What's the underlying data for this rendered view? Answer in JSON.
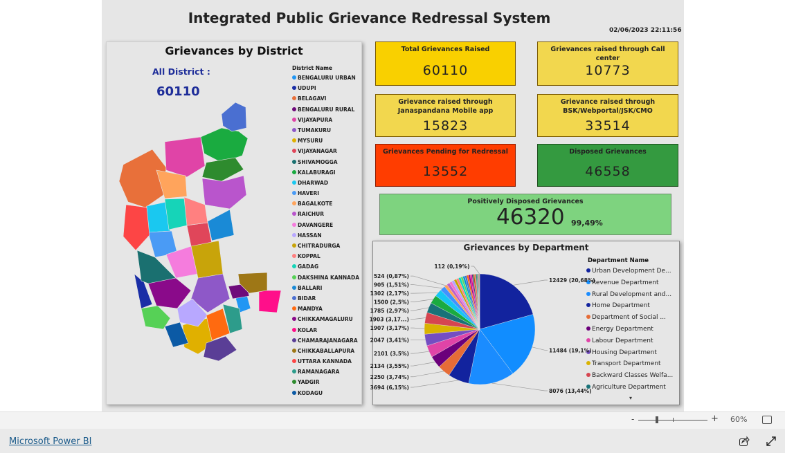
{
  "report": {
    "title": "Integrated Public Grievance Redressal System",
    "timestamp": "02/06/2023 22:11:56"
  },
  "district_panel": {
    "title": "Grievances by District",
    "all_label": "All District :",
    "all_value": "60110",
    "legend_title": "District Name",
    "districts": [
      {
        "name": "BENGALURU URBAN",
        "color": "#2196f3"
      },
      {
        "name": "UDUPI",
        "color": "#1a2ea6"
      },
      {
        "name": "BELAGAVI",
        "color": "#e8703a"
      },
      {
        "name": "BENGALURU RURAL",
        "color": "#6e0a7a"
      },
      {
        "name": "VIJAYAPURA",
        "color": "#e044a7"
      },
      {
        "name": "TUMAKURU",
        "color": "#8e58c8"
      },
      {
        "name": "MYSURU",
        "color": "#e0b000"
      },
      {
        "name": "VIJAYANAGAR",
        "color": "#e0465a"
      },
      {
        "name": "SHIVAMOGGA",
        "color": "#1a7070"
      },
      {
        "name": "KALABURAGI",
        "color": "#1aab40"
      },
      {
        "name": "DHARWAD",
        "color": "#1ac8f0"
      },
      {
        "name": "HAVERI",
        "color": "#4a9bf5"
      },
      {
        "name": "BAGALKOTE",
        "color": "#ffa45c"
      },
      {
        "name": "RAICHUR",
        "color": "#b955cc"
      },
      {
        "name": "DAVANGERE",
        "color": "#f57cdd"
      },
      {
        "name": "HASSAN",
        "color": "#b8a8ff"
      },
      {
        "name": "CHITRADURGA",
        "color": "#c8a40a"
      },
      {
        "name": "KOPPAL",
        "color": "#ff8080"
      },
      {
        "name": "GADAG",
        "color": "#16d4b8"
      },
      {
        "name": "DAKSHINA KANNADA",
        "color": "#56d156"
      },
      {
        "name": "BALLARI",
        "color": "#1a8ad6"
      },
      {
        "name": "BIDAR",
        "color": "#4a6fd1"
      },
      {
        "name": "MANDYA",
        "color": "#ff6a10"
      },
      {
        "name": "CHIKKAMAGALURU",
        "color": "#8a0a8a"
      },
      {
        "name": "KOLAR",
        "color": "#ff0f8a"
      },
      {
        "name": "CHAMARAJANAGARA",
        "color": "#5a3e96"
      },
      {
        "name": "CHIKKABALLAPURA",
        "color": "#9e7716"
      },
      {
        "name": "UTTARA KANNADA",
        "color": "#fd4545"
      },
      {
        "name": "RAMANAGARA",
        "color": "#2d9c8b"
      },
      {
        "name": "YADGIR",
        "color": "#2e8b2e"
      },
      {
        "name": "KODAGU",
        "color": "#0b5aa5"
      }
    ]
  },
  "cards": {
    "total": {
      "title": "Total Grievances Raised",
      "value": "60110",
      "color": "#f9d000"
    },
    "call_center": {
      "title": "Grievances raised through Call center",
      "value": "10773",
      "color": "#f2d74e"
    },
    "janaspandana": {
      "title": "Grievance raised through Janaspandana Mobile app",
      "value": "15823",
      "color": "#f2d74e"
    },
    "bsk": {
      "title": "Grievance raised through BSK/Webportal/JSK/CMO",
      "value": "33514",
      "color": "#f2d74e"
    },
    "pending": {
      "title": "Grievances Pending for Redressal",
      "value": "13552",
      "color": "#ff3d00"
    },
    "disposed": {
      "title": "Disposed Grievances",
      "value": "46558",
      "color": "#349a40"
    },
    "positive": {
      "title": "Positively Disposed Grievances",
      "value": "46320",
      "percent": "99,49%",
      "color": "#7ed37f"
    }
  },
  "chart_data": {
    "type": "pie",
    "title": "Grievances by Department",
    "legend_title": "Department Name",
    "legend_placement": "right",
    "legend_items": [
      {
        "name": "Urban Development De...",
        "color": "#12239e"
      },
      {
        "name": "Revenue Department",
        "color": "#118dff"
      },
      {
        "name": "Rural Development and...",
        "color": "#1a8cff"
      },
      {
        "name": "Home Department",
        "color": "#12239e"
      },
      {
        "name": "Department of Social ...",
        "color": "#e66c37"
      },
      {
        "name": "Energy Department",
        "color": "#6b007b"
      },
      {
        "name": "Labour Department",
        "color": "#e044a7"
      },
      {
        "name": "Housing Department",
        "color": "#744ec2"
      },
      {
        "name": "Transport Department",
        "color": "#d9b300"
      },
      {
        "name": "Backward Classes Welfa...",
        "color": "#d64550"
      },
      {
        "name": "Agriculture Department",
        "color": "#197278"
      }
    ],
    "slices": [
      {
        "value": 12429,
        "label": "12429 (20,68%)",
        "color": "#12239e"
      },
      {
        "value": 11484,
        "label": "11484 (19,1%)",
        "color": "#118dff"
      },
      {
        "value": 8076,
        "label": "8076 (13,44%)",
        "color": "#1a8cff"
      },
      {
        "value": 3694,
        "label": "3694 (6,15%)",
        "color": "#12239e"
      },
      {
        "value": 2250,
        "label": "2250 (3,74%)",
        "color": "#e66c37"
      },
      {
        "value": 2134,
        "label": "2134 (3,55%)",
        "color": "#6b007b"
      },
      {
        "value": 2101,
        "label": "2101 (3,5%)",
        "color": "#e044a7"
      },
      {
        "value": 2047,
        "label": "2047 (3,41%)",
        "color": "#744ec2"
      },
      {
        "value": 1907,
        "label": "1907 (3,17%)",
        "color": "#d9b300"
      },
      {
        "value": 1903,
        "label": "1903 (3,17...)",
        "color": "#d64550"
      },
      {
        "value": 1785,
        "label": "1785 (2,97%)",
        "color": "#197278"
      },
      {
        "value": 1500,
        "label": "1500 (2,5%)",
        "color": "#1aab40"
      },
      {
        "value": 1302,
        "label": "1302 (2,17%)",
        "color": "#15c6f4"
      },
      {
        "value": 905,
        "label": "905 (1,51%)",
        "color": "#4092ff"
      },
      {
        "value": 524,
        "label": "524 (0,87%)",
        "color": "#ffa058"
      },
      {
        "value": 500,
        "label": "",
        "color": "#be5dc9"
      },
      {
        "value": 480,
        "label": "",
        "color": "#f472d0"
      },
      {
        "value": 460,
        "label": "",
        "color": "#b5a1ff"
      },
      {
        "value": 440,
        "label": "",
        "color": "#c4a200"
      },
      {
        "value": 420,
        "label": "",
        "color": "#ff8080"
      },
      {
        "value": 400,
        "label": "",
        "color": "#00dbbc"
      },
      {
        "value": 380,
        "label": "",
        "color": "#5bd667"
      },
      {
        "value": 360,
        "label": "",
        "color": "#0091d5"
      },
      {
        "value": 340,
        "label": "",
        "color": "#4668c5"
      },
      {
        "value": 320,
        "label": "",
        "color": "#ff6300"
      },
      {
        "value": 300,
        "label": "",
        "color": "#99008a"
      },
      {
        "value": 280,
        "label": "",
        "color": "#ec008c"
      },
      {
        "value": 260,
        "label": "",
        "color": "#533285"
      },
      {
        "value": 240,
        "label": "",
        "color": "#99700a"
      },
      {
        "value": 220,
        "label": "",
        "color": "#ff4141"
      },
      {
        "value": 200,
        "label": "",
        "color": "#1f9a85"
      },
      {
        "value": 120,
        "label": "",
        "color": "#255a26"
      },
      {
        "value": 120,
        "label": "",
        "color": "#0e5ba5"
      },
      {
        "value": 117,
        "label": "",
        "color": "#b83a3a"
      },
      {
        "value": 112,
        "label": "112 (0,19%)",
        "color": "#8a8a2e"
      }
    ]
  },
  "status_bar": {
    "zoom_minus": "-",
    "zoom_plus": "+",
    "zoom_level": "60%"
  },
  "footer": {
    "brand_link": "Microsoft Power BI"
  }
}
